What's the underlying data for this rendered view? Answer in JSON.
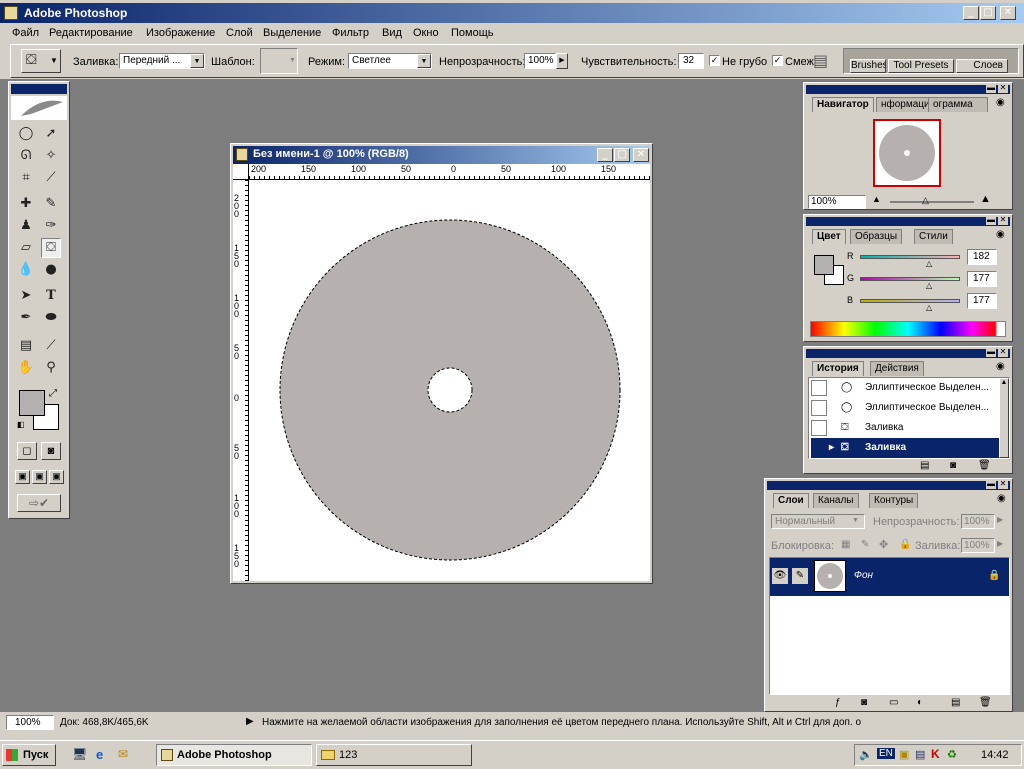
{
  "app": {
    "title": "Adobe Photoshop"
  },
  "menu": [
    "Файл",
    "Редактирование",
    "Изображение",
    "Слой",
    "Выделение",
    "Фильтр",
    "Вид",
    "Окно",
    "Помощь"
  ],
  "options": {
    "fill_label": "Заливка:",
    "fill_value": "Передний ...",
    "pattern_label": "Шаблон:",
    "mode_label": "Режим:",
    "mode_value": "Светлее",
    "opacity_label": "Непрозрачность:",
    "opacity_value": "100%",
    "tolerance_label": "Чувствительность:",
    "tolerance_value": "32",
    "antialias_label": "Не грубо",
    "contiguous_label": "Смеж",
    "well_tabs": [
      "Brushes",
      "Tool Presets",
      "Слоев"
    ]
  },
  "document": {
    "title": "Без имени-1 @ 100% (RGB/8)",
    "ruler_top": [
      "200",
      "150",
      "100",
      "50",
      "0",
      "50",
      "100",
      "150"
    ],
    "ruler_left": [
      "2 0 0",
      "1 5 0",
      "1 0 0",
      "5 0",
      "0",
      "5 0",
      "1 0 0",
      "1 5 0"
    ],
    "disc_color": "#b6b1ae"
  },
  "navigator": {
    "tabs": [
      "Навигатор",
      "нформация",
      "ограмма"
    ],
    "zoom": "100%"
  },
  "color_panel": {
    "tabs": [
      "Цвет",
      "Образцы",
      "Стили"
    ],
    "channels": [
      {
        "label": "R",
        "value": "182"
      },
      {
        "label": "G",
        "value": "177"
      },
      {
        "label": "B",
        "value": "177"
      }
    ]
  },
  "history": {
    "tabs": [
      "История",
      "Действия"
    ],
    "items": [
      "Эллиптическое Выделен...",
      "Эллиптическое Выделен...",
      "Заливка",
      "Заливка"
    ]
  },
  "layers": {
    "tabs": [
      "Слои",
      "Каналы",
      "Контуры"
    ],
    "blend_mode": "Нормальный",
    "opacity_label": "Непрозрачность:",
    "opacity_value": "100%",
    "lock_label": "Блокировка:",
    "fill_label": "Заливка:",
    "fill_value": "100%",
    "layer_name": "Фон"
  },
  "status": {
    "zoom": "100%",
    "doc": "Док: 468,8K/465,6K",
    "hint": "Нажмите на желаемой области изображения для заполнения её цветом переднего плана. Используйте Shift, Alt и Ctrl для доп. о"
  },
  "taskbar": {
    "start": "Пуск",
    "task1": "Adobe Photoshop",
    "task2": "123",
    "lang": "EN",
    "time": "14:42"
  },
  "colors": {
    "foreground": "#b6b1b1",
    "background": "#ffffff",
    "titlebar": "#0a246a"
  }
}
